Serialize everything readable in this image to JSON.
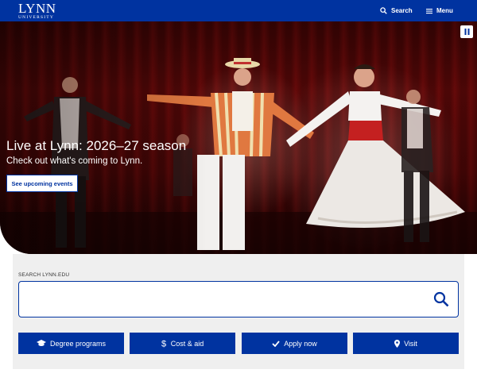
{
  "header": {
    "logo_main": "LYNN",
    "logo_sub": "UNIVERSITY",
    "search_label": "Search",
    "menu_label": "Menu",
    "background_color": "#0033a0"
  },
  "hero": {
    "title": "Live at Lynn: 2026–27 season",
    "subtitle": "Check out what's coming to Lynn.",
    "cta_label": "See upcoming events",
    "pause_icon": "pause-icon"
  },
  "search": {
    "label": "SEARCH LYNN.EDU",
    "value": "",
    "icon": "search-icon"
  },
  "quick_links": [
    {
      "label": "Degree programs",
      "icon": "graduation-cap-icon"
    },
    {
      "label": "Cost & aid",
      "icon": "dollar-icon"
    },
    {
      "label": "Apply now",
      "icon": "checkmark-icon"
    },
    {
      "label": "Visit",
      "icon": "map-pin-icon"
    }
  ],
  "colors": {
    "brand_blue": "#0033a0",
    "panel_gray": "#efefef"
  }
}
